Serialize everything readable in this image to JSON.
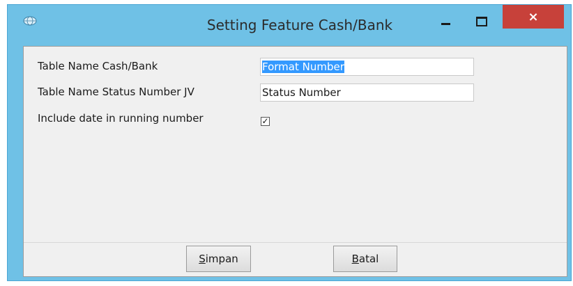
{
  "window": {
    "title": "Setting Feature Cash/Bank",
    "icon": "app-globe-icon",
    "controls": {
      "minimize": "minimize-icon",
      "maximize": "maximize-icon",
      "close": "×"
    }
  },
  "form": {
    "cash_bank_label": "Table Name Cash/Bank",
    "cash_bank_value": "Format Number",
    "status_number_label": "Table Name Status Number JV",
    "status_number_value": "Status Number",
    "include_date_label": "Include date in running number",
    "include_date_checked": "✓"
  },
  "buttons": {
    "save_first": "S",
    "save_rest": "impan",
    "cancel_first": "B",
    "cancel_rest": "atal"
  },
  "colors": {
    "frame": "#6fc1e6",
    "close": "#c7413a",
    "selection": "#3399ff"
  }
}
